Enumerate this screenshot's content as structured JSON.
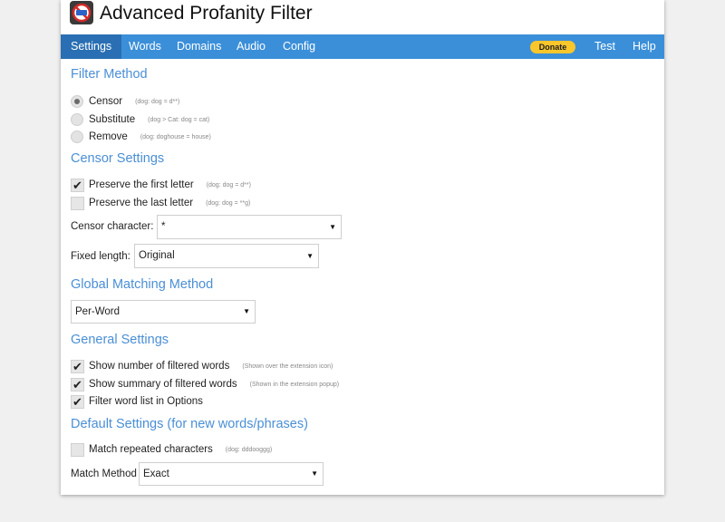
{
  "header": {
    "title": "Advanced Profanity Filter"
  },
  "nav": {
    "items": [
      {
        "label": "Settings",
        "active": true
      },
      {
        "label": "Words"
      },
      {
        "label": "Domains"
      },
      {
        "label": "Audio"
      },
      {
        "label": "Config"
      }
    ],
    "donate_label": "Donate",
    "test_label": "Test",
    "help_label": "Help"
  },
  "filter_method": {
    "title": "Filter Method",
    "options": [
      {
        "label": "Censor",
        "hint": "(dog: dog = d**)",
        "checked": true
      },
      {
        "label": "Substitute",
        "hint": "(dog > Cat: dog = cat)",
        "checked": false
      },
      {
        "label": "Remove",
        "hint": "(dog: doghouse = house)",
        "checked": false
      }
    ]
  },
  "censor_settings": {
    "title": "Censor Settings",
    "preserve_first": {
      "label": "Preserve the first letter",
      "hint": "(dog: dog = d**)",
      "checked": true
    },
    "preserve_last": {
      "label": "Preserve the last letter",
      "hint": "(dog: dog = **g)",
      "checked": false
    },
    "censor_character_label": "Censor character:",
    "censor_character_value": "*",
    "fixed_length_label": "Fixed length:",
    "fixed_length_value": "Original"
  },
  "global_matching": {
    "title": "Global Matching Method",
    "value": "Per-Word"
  },
  "general_settings": {
    "title": "General Settings",
    "show_count": {
      "label": "Show number of filtered words",
      "hint": "(Shown over the extension icon)",
      "checked": true
    },
    "show_summary": {
      "label": "Show summary of filtered words",
      "hint": "(Shown in the extension popup)",
      "checked": true
    },
    "filter_word_list": {
      "label": "Filter word list in Options",
      "checked": true
    }
  },
  "default_settings": {
    "title": "Default Settings (for new words/phrases)",
    "match_repeated": {
      "label": "Match repeated characters",
      "hint": "(dog: dddooggg)",
      "checked": false
    },
    "match_method_label": "Match Method",
    "match_method_value": "Exact"
  },
  "colors": {
    "nav_bg": "#3b8fd9",
    "nav_active": "#2a6fb3",
    "section_title": "#4a8fd6",
    "donate_bg": "#f9c62c"
  }
}
